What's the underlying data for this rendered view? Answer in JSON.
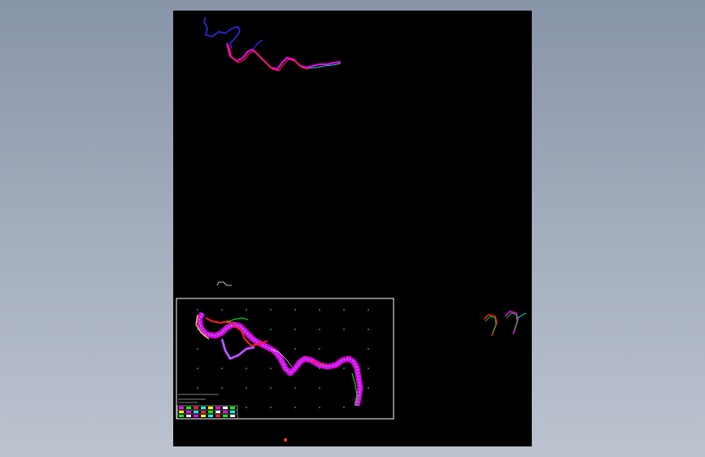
{
  "viewport": {
    "background_top": "#8894a8",
    "background_bottom": "#bcc3cf"
  },
  "drawing": {
    "canvas_color": "#000000",
    "title_frame_color": "#ffffff",
    "layer_colors": {
      "magenta": "#ff00ff",
      "red": "#ff2020",
      "blue": "#3030ff",
      "cyan": "#00ffff",
      "green": "#00ff00",
      "yellow": "#ffff00",
      "white": "#ffffff"
    }
  }
}
